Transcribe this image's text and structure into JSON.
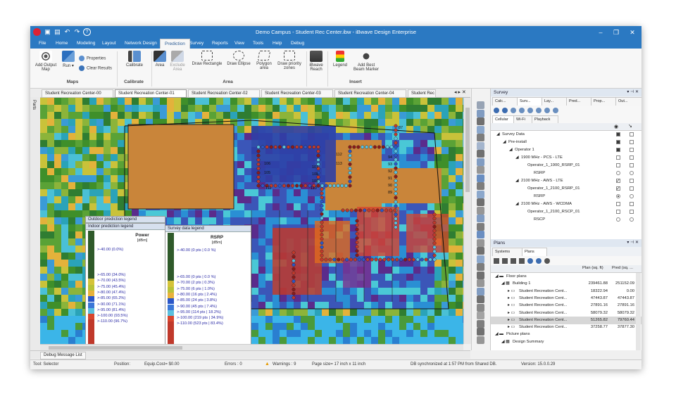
{
  "window": {
    "title": "Demo Campus - Student Rec Center.ibw - iBwave Design Enterprise"
  },
  "menu": [
    "File",
    "Home",
    "Modeling",
    "Layout",
    "Network Design",
    "Prediction",
    "Survey",
    "Reports",
    "View",
    "Tools",
    "Help",
    "Debug"
  ],
  "menu_active": "Prediction",
  "ribbon": {
    "add_output_map": "Add Output Map",
    "run": "Run",
    "properties": "Properties",
    "clear_results": "Clear Results",
    "group_maps": "Maps",
    "calibrate": "Calibrate",
    "group_calibrate": "Calibrate",
    "area": "Area",
    "exclude_area": "Exclude Area",
    "draw_rectangle": "Draw Rectangle",
    "draw_ellipse": "Draw Ellipse",
    "polygon_area": "Polygon area",
    "draw_priority_zones": "Draw priority zones",
    "group_area": "Area",
    "ibwave_reach": "iBwave Reach",
    "legend": "Legend",
    "add_best_beam_marker": "Add Best Beam Marker",
    "group_insert": "Insert"
  },
  "doc_tabs": [
    "Student Recreation Center-00",
    "Student Recreation Center-01",
    "Student Recreation Center-02",
    "Student Recreation Center-03",
    "Student Recreation Center-04",
    "Student Rec"
  ],
  "doc_tab_active": 1,
  "parts_label": "Parts",
  "map_points": [
    "87",
    "94",
    "93",
    "92",
    "91",
    "90",
    "89",
    "106",
    "105",
    "108",
    "109",
    "111",
    "110",
    "107",
    "112",
    "113"
  ],
  "outdoor_legend": {
    "header": "Outdoor prediction legend"
  },
  "indoor_legend": {
    "header": "Indoor prediction legend",
    "title": "Power",
    "unit": "[dBm]",
    "top": ">-40.00 (0.0%)",
    "items": [
      ">-65.00 (34.0%)",
      ">-70.00 (43.5%)",
      ">-75.00 (45.4%)",
      ">-80.00 (47.4%)",
      ">-85.00 (65.2%)",
      ">-90.00 (71.1%)",
      ">-95.00 (81.4%)",
      ">-100.00 (93.5%)",
      ">-110.00 (96.7%)"
    ]
  },
  "survey_legend": {
    "header": "Survey data legend",
    "title": "RSRP",
    "unit": "[dBm]",
    "top": ">-40.00 (0 pts | 0.0 %)",
    "items": [
      ">-65.00 (0 pts | 0.0 %)",
      ">-70.00 (2 pts | 0.3%)",
      ">-75.00 (6 pts | 1.0%)",
      ">-80.00 (16 pts | 2.4%)",
      ">-85.00 (24 pts | 3.8%)",
      ">-90.00 (45 pts | 7.4%)",
      ">-95.00 (114 pts | 18.2%)",
      ">-100.00 (219 pts | 34.9%)",
      ">-110.00 (523 pts | 83.4%)"
    ]
  },
  "survey_panel": {
    "title": "Survey",
    "tabs": [
      "Calc...",
      "Surv...",
      "Lay...",
      "Pred...",
      "Prop...",
      "Out..."
    ],
    "subtabs": [
      "Cellular",
      "Wi-Fi",
      "Playback"
    ],
    "rows": [
      {
        "label": "Survey Data",
        "indent": 0
      },
      {
        "label": "Pre-install",
        "indent": 1
      },
      {
        "label": "Operator 1",
        "indent": 2
      },
      {
        "label": "1900 MHz - PCS - LTE",
        "indent": 3
      },
      {
        "label": "Operator_1_1900_RSRP_01",
        "indent": 4
      },
      {
        "label": "RSRP",
        "indent": 5
      },
      {
        "label": "2100 MHz - AWS - LTE",
        "indent": 3
      },
      {
        "label": "Operator_1_2100_RSRP_01",
        "indent": 4
      },
      {
        "label": "RSRP",
        "indent": 5
      },
      {
        "label": "2100 MHz - AWS - WCDMA",
        "indent": 3
      },
      {
        "label": "Operator_1_2100_RSCP_01",
        "indent": 4
      },
      {
        "label": "RSCP",
        "indent": 5
      }
    ]
  },
  "plans_panel": {
    "title": "Plans",
    "tabs": [
      "Systems",
      "Plans"
    ],
    "col_plan": "Plan (sq. ft)",
    "col_pred": "Pred (sq. ...",
    "rows": [
      {
        "label": "Floor plans",
        "plan": "",
        "pred": "",
        "indent": 0
      },
      {
        "label": "Building 1",
        "plan": "239461.88",
        "pred": "251152.09",
        "indent": 1
      },
      {
        "label": "Student Recreation Cent...",
        "plan": "18322.94",
        "pred": "0.00",
        "indent": 2
      },
      {
        "label": "Student Recreation Cent...",
        "plan": "47443.87",
        "pred": "47443.87",
        "indent": 2
      },
      {
        "label": "Student Recreation Cent...",
        "plan": "27891.16",
        "pred": "27891.16",
        "indent": 2
      },
      {
        "label": "Student Recreation Cent...",
        "plan": "58079.32",
        "pred": "58079.32",
        "indent": 2
      },
      {
        "label": "Student Recreation Cent...",
        "plan": "51265.82",
        "pred": "79760.44",
        "indent": 2
      },
      {
        "label": "Student Recreation Cent...",
        "plan": "37258.77",
        "pred": "37877.30",
        "indent": 2
      },
      {
        "label": "Picture plans",
        "plan": "",
        "pred": "",
        "indent": 0
      },
      {
        "label": "Design Summary",
        "plan": "",
        "pred": "",
        "indent": 1
      }
    ]
  },
  "debug_tab": "Debug Message List",
  "status": {
    "tool": "Tool: Selector",
    "position": "Position:",
    "equip_cost": "Equip.Cost= $0.00",
    "errors": "Errors : 0",
    "warnings": "Warnings : 9",
    "page_size": "Page size= 17 inch x 11 inch",
    "db": "DB synchronized at 1:57 PM from Shared DB.",
    "version": "Version: 15.0.0.29"
  },
  "colors": {
    "accent": "#2b79c2",
    "warning": "#e59a00"
  }
}
